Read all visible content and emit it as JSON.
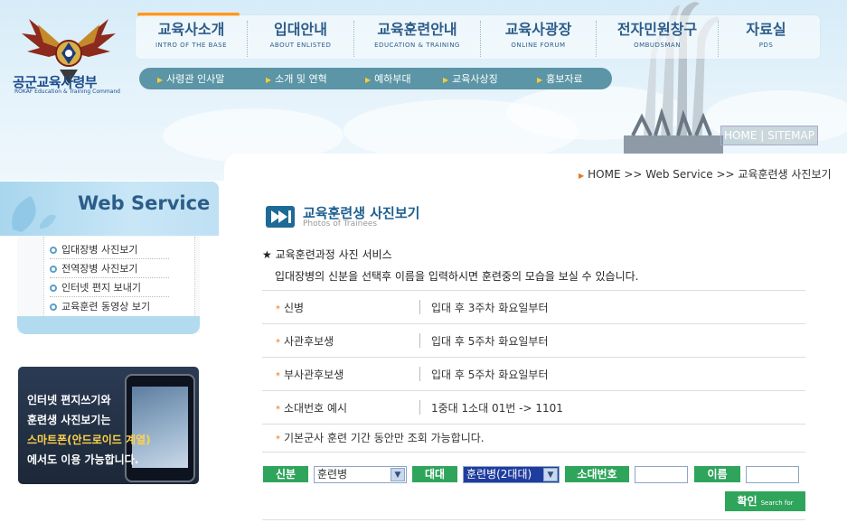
{
  "logo": {
    "title": "공군교육사령부",
    "subtitle": "ROKAF Education & Training Command"
  },
  "main_nav": [
    {
      "ko": "교육사소개",
      "en": "INTRO OF THE BASE"
    },
    {
      "ko": "입대안내",
      "en": "ABOUT ENLISTED"
    },
    {
      "ko": "교육훈련안내",
      "en": "EDUCATION & TRAINING"
    },
    {
      "ko": "교육사광장",
      "en": "ONLINE FORUM"
    },
    {
      "ko": "전자민원창구",
      "en": "OMBUDSMAN"
    },
    {
      "ko": "자료실",
      "en": "PDS"
    }
  ],
  "sub_nav": [
    "사령관 인사말",
    "소개 및 연혁",
    "예하부대",
    "교육사상징",
    "홍보자료"
  ],
  "header_links": {
    "home": "HOME",
    "sep": "|",
    "sitemap": "SITEMAP"
  },
  "breadcrumb": "HOME >> Web Service >> 교육훈련생 사진보기",
  "sidebar": {
    "title": "Web Service",
    "items": [
      "입대장병 사진보기",
      "전역장병 사진보기",
      "인터넷 편지 보내기",
      "교육훈련 동영상 보기"
    ]
  },
  "banner": {
    "line1": "인터넷 편지쓰기와",
    "line2": "훈련생 사진보기는",
    "line3": "스마트폰(안드로이드 계열)",
    "line4": "에서도 이용 가능합니다."
  },
  "content": {
    "title": "교육훈련생 사진보기",
    "subtitle": "Photos of Trainees",
    "service_title": "★ 교육훈련과정 사진 서비스",
    "service_desc": "입대장병의 신분을 선택후 이름을 입력하시면 훈련중의 모습을 보실 수 있습니다.",
    "rows": [
      {
        "label": "신병",
        "value": "입대 후 3주차 화요일부터"
      },
      {
        "label": "사관후보생",
        "value": "입대 후 5주차 화요일부터"
      },
      {
        "label": "부사관후보생",
        "value": "입대 후 5주차 화요일부터"
      },
      {
        "label": "소대번호 예시",
        "value": "1중대 1소대 01번 -> 1101"
      }
    ],
    "note": "기본군사 훈련 기간 동안만 조회 가능합니다."
  },
  "form": {
    "status_label": "신분",
    "status_value": "훈련병",
    "unit_label": "대대",
    "unit_value": "훈련병(2대대)",
    "platoon_label": "소대번호",
    "platoon_value": "",
    "name_label": "이름",
    "name_value": "",
    "confirm_label": "확인",
    "confirm_sub": "Search for"
  },
  "colors": {
    "accent_green": "#2fa45b",
    "nav_text": "#2d5c8a",
    "orange": "#ff9a1f"
  }
}
